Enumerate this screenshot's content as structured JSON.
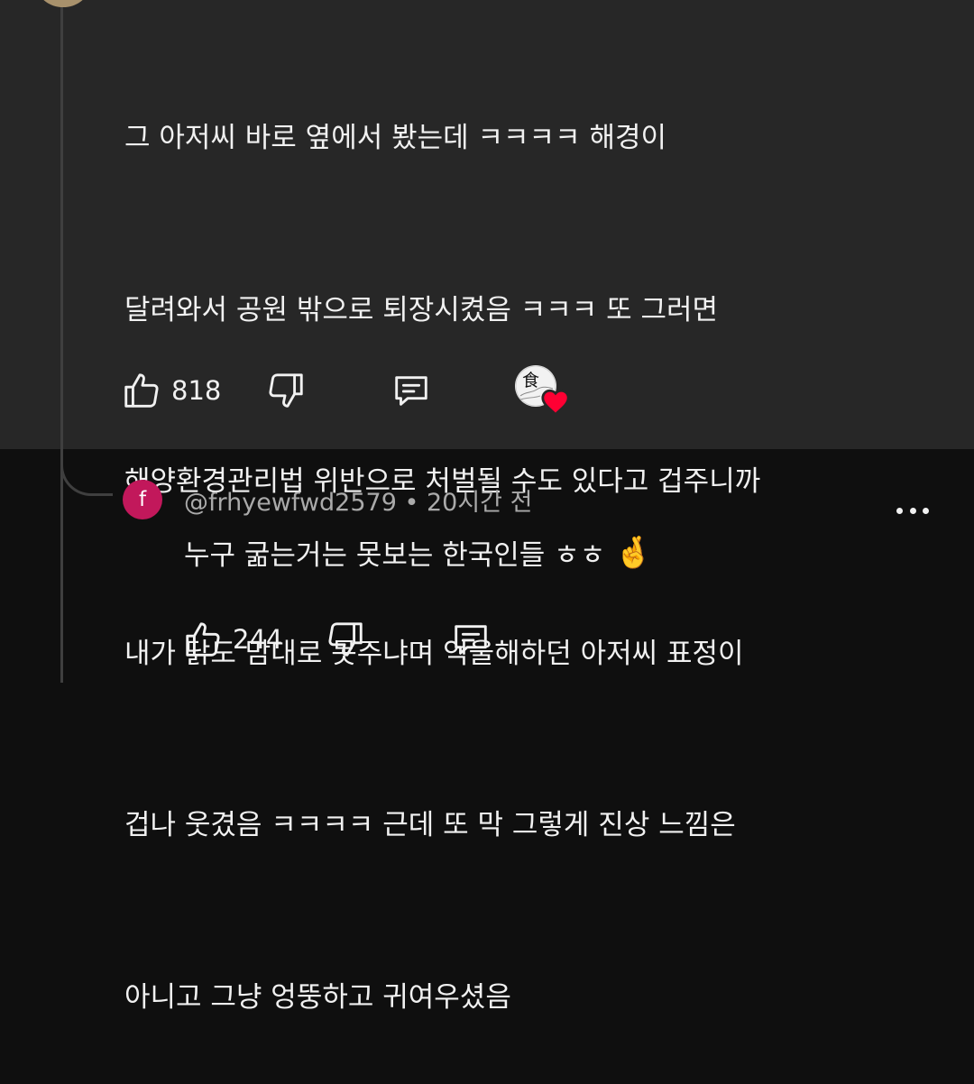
{
  "parent_comment": {
    "lines": [
      "그 아저씨 바로 옆에서 봤는데 ㅋㅋㅋㅋ 해경이",
      "달려와서 공원 밖으로 퇴장시켰음 ㅋㅋㅋ 또 그러면",
      "해양환경관리법 위반으로 처벌될 수도 있다고 겁주니까",
      "내가 닭도 맘대로 못주냐며 억울해하던 아저씨 표정이",
      "겁나 웃겼음 ㅋㅋㅋㅋ 근데 또 막 그렇게 진상 느낌은",
      "아니고 그냥 엉뚱하고 귀여우셨음"
    ],
    "like_count": "818",
    "creator_avatar_glyph": "食"
  },
  "reply": {
    "avatar_letter": "f",
    "author": "@frhyewfwd2579",
    "separator": " • ",
    "time": "20시간 전",
    "text": "누구 굶는거는 못보는 한국인들 ㅎㅎ ",
    "emoji": "🤞",
    "like_count": "244"
  },
  "colors": {
    "background": "#0f0f0f",
    "highlight_block": "#272727",
    "text": "#f1f1f1",
    "secondary_text": "#aaaaaa",
    "reply_avatar": "#c2185b",
    "heart": "#ff0033"
  }
}
